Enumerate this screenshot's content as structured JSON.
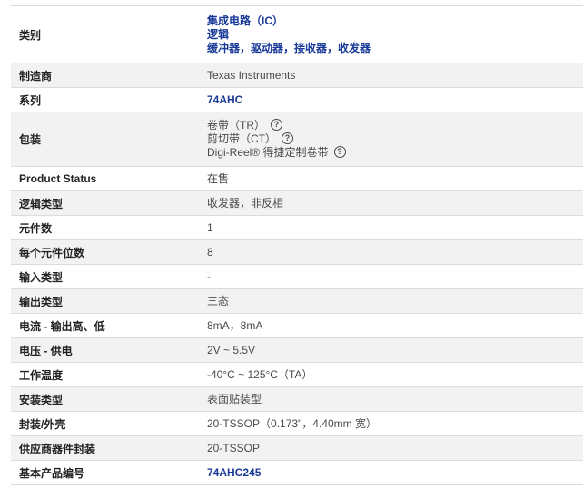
{
  "rows": [
    {
      "label": "类别",
      "lines": [
        "集成电路（IC）",
        "逻辑",
        "缓冲器，驱动器，接收器，收发器"
      ],
      "link": true
    },
    {
      "label": "制造商",
      "lines": [
        "Texas Instruments"
      ]
    },
    {
      "label": "系列",
      "lines": [
        "74AHC"
      ],
      "link": true
    },
    {
      "label": "包装",
      "lines": [
        "卷带（TR）",
        "剪切带（CT）",
        "Digi-Reel® 得捷定制卷带"
      ],
      "help_icon": "question-circle-icon"
    },
    {
      "label": "Product Status",
      "lines": [
        "在售"
      ]
    },
    {
      "label": "逻辑类型",
      "lines": [
        "收发器，非反相"
      ]
    },
    {
      "label": "元件数",
      "lines": [
        "1"
      ]
    },
    {
      "label": "每个元件位数",
      "lines": [
        "8"
      ]
    },
    {
      "label": "输入类型",
      "lines": [
        "-"
      ]
    },
    {
      "label": "输出类型",
      "lines": [
        "三态"
      ]
    },
    {
      "label": "电流 - 输出高、低",
      "lines": [
        "8mA，8mA"
      ]
    },
    {
      "label": "电压 - 供电",
      "lines": [
        "2V ~ 5.5V"
      ]
    },
    {
      "label": "工作温度",
      "lines": [
        "-40°C ~ 125°C（TA）"
      ]
    },
    {
      "label": "安装类型",
      "lines": [
        "表面贴装型"
      ]
    },
    {
      "label": "封装/外壳",
      "lines": [
        "20-TSSOP（0.173\"，4.40mm 宽）"
      ]
    },
    {
      "label": "供应商器件封装",
      "lines": [
        "20-TSSOP"
      ]
    },
    {
      "label": "基本产品编号",
      "lines": [
        "74AHC245"
      ],
      "link": true
    }
  ],
  "colors": {
    "link": "#1a3a99",
    "row_alt": "#f2f2f2",
    "border": "#dcdcdc"
  }
}
